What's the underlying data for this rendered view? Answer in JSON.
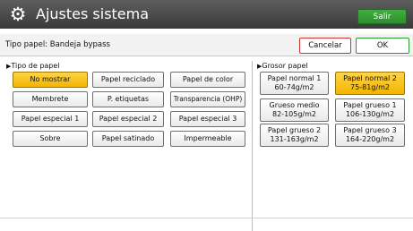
{
  "window": {
    "title": "Ajustes sistema",
    "exit_label": "Salir"
  },
  "infobar": {
    "label": "Tipo papel: Bandeja bypass",
    "cancel_label": "Cancelar",
    "ok_label": "OK"
  },
  "paper_type": {
    "heading": "Tipo de papel",
    "selected": "No mostrar",
    "options": [
      "No mostrar",
      "Papel reciclado",
      "Papel de color",
      "Membrete",
      "P. etiquetas",
      "Transparencia (OHP)",
      "Papel especial 1",
      "Papel especial 2",
      "Papel especial 3",
      "Sobre",
      "Papel satinado",
      "Impermeable"
    ]
  },
  "paper_weight": {
    "heading": "Grosor papel",
    "selected": "Papel normal 2",
    "options": [
      {
        "name": "Papel normal 1",
        "range": "60-74g/m2"
      },
      {
        "name": "Papel normal 2",
        "range": "75-81g/m2"
      },
      {
        "name": "Grueso medio",
        "range": "82-105g/m2"
      },
      {
        "name": "Papel grueso 1",
        "range": "106-130g/m2"
      },
      {
        "name": "Papel grueso 2",
        "range": "131-163g/m2"
      },
      {
        "name": "Papel grueso 3",
        "range": "164-220g/m2"
      }
    ]
  },
  "colors": {
    "selected": "#f5be12",
    "exit": "#2e9a2e",
    "cancel_border": "#cc3333",
    "ok_border": "#2a9a2a",
    "titlebar": "#4a4a4a"
  },
  "icons": {
    "title_icon": "gear-icon",
    "section_marker": "triangle-right-icon"
  }
}
